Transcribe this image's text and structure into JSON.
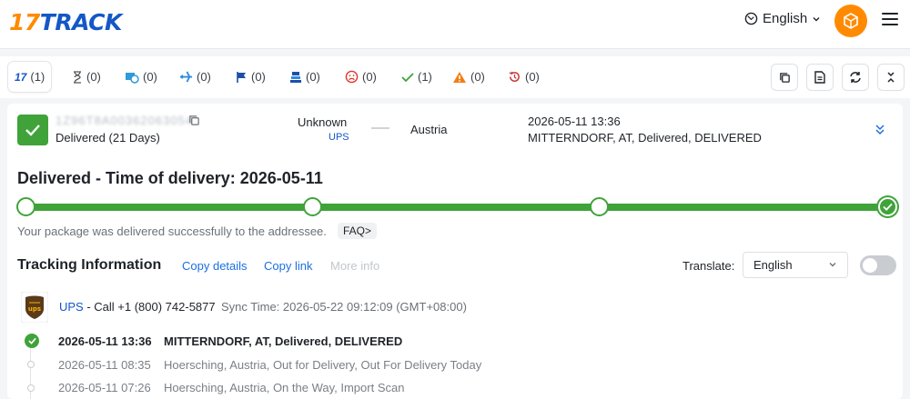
{
  "header": {
    "logo_num": "17",
    "logo_word": "TRACK",
    "language": "English"
  },
  "tabs": [
    {
      "icon": "17track-icon",
      "count": "(1)"
    },
    {
      "icon": "hourglass-icon",
      "count": "(0)"
    },
    {
      "icon": "truck-clock-icon",
      "count": "(0)"
    },
    {
      "icon": "airplane-icon",
      "count": "(0)"
    },
    {
      "icon": "flag-icon",
      "count": "(0)"
    },
    {
      "icon": "package-stack-icon",
      "count": "(0)"
    },
    {
      "icon": "sad-face-icon",
      "count": "(0)"
    },
    {
      "icon": "check-icon",
      "count": "(1)"
    },
    {
      "icon": "warning-icon",
      "count": "(0)"
    },
    {
      "icon": "history-icon",
      "count": "(0)"
    }
  ],
  "shipment": {
    "tracking_number": "1Z96T8A00362063054",
    "status_days": "Delivered (21 Days)",
    "origin": "Unknown",
    "carrier_short": "UPS",
    "destination": "Austria",
    "last_time": "2026-05-11 13:36",
    "last_event": "MITTERNDORF, AT, Delivered, DELIVERED"
  },
  "delivery": {
    "headline": "Delivered - Time of delivery: 2026-05-11",
    "note": "Your package was delivered successfully to the addressee.",
    "faq": "FAQ>",
    "progress_fraction": 1.0
  },
  "tracking_info": {
    "title": "Tracking Information",
    "copy_details": "Copy details",
    "copy_link": "Copy link",
    "more_info": "More info",
    "translate_label": "Translate:",
    "translate_value": "English"
  },
  "carrier": {
    "name": "UPS",
    "call": " - Call +1 (800) 742-5877",
    "sync": "Sync Time: 2026-05-22 09:12:09 (GMT+08:00)"
  },
  "events": [
    {
      "time": "2026-05-11 13:36",
      "desc": "MITTERNDORF, AT, Delivered, DELIVERED"
    },
    {
      "time": "2026-05-11 08:35",
      "desc": "Hoersching, Austria, Out for Delivery, Out For Delivery Today"
    },
    {
      "time": "2026-05-11 07:26",
      "desc": "Hoersching, Austria, On the Way, Import Scan"
    }
  ],
  "colors": {
    "brand_orange": "#ff8a00",
    "brand_blue": "#1457c7",
    "delivered_green": "#3fa33a",
    "link_blue": "#1b6fe0"
  }
}
